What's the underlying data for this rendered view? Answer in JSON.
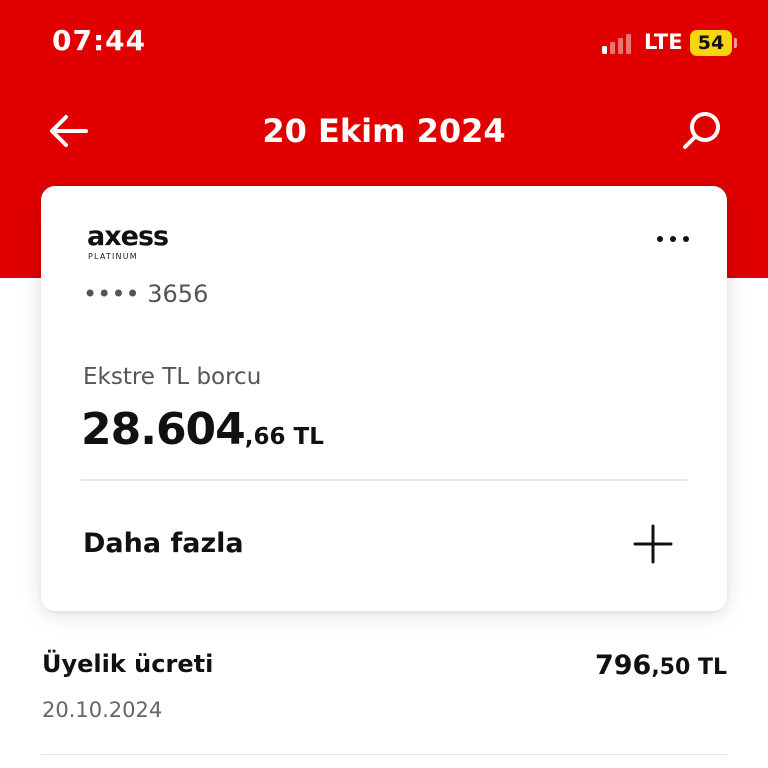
{
  "status_bar": {
    "time": "07:44",
    "network": "LTE",
    "battery": "54"
  },
  "header": {
    "title": "20 Ekim 2024",
    "back_icon": "arrow-left-icon",
    "search_icon": "search-icon"
  },
  "card": {
    "brand": "axess",
    "brand_sub": "PLATINUM",
    "number": "•••• 3656",
    "debt_label": "Ekstre TL borcu",
    "debt_whole": "28.604",
    "debt_fraction": ",66 TL",
    "more_label": "Daha fazla",
    "more_icon": "plus-icon",
    "menu_icon": "more-dots-icon"
  },
  "transactions": [
    {
      "title": "Üyelik ücreti",
      "date": "20.10.2024",
      "amount_whole": "796",
      "amount_fraction": ",50 TL"
    }
  ],
  "colors": {
    "brand_red": "#e00000",
    "battery": "#f5d60f"
  }
}
